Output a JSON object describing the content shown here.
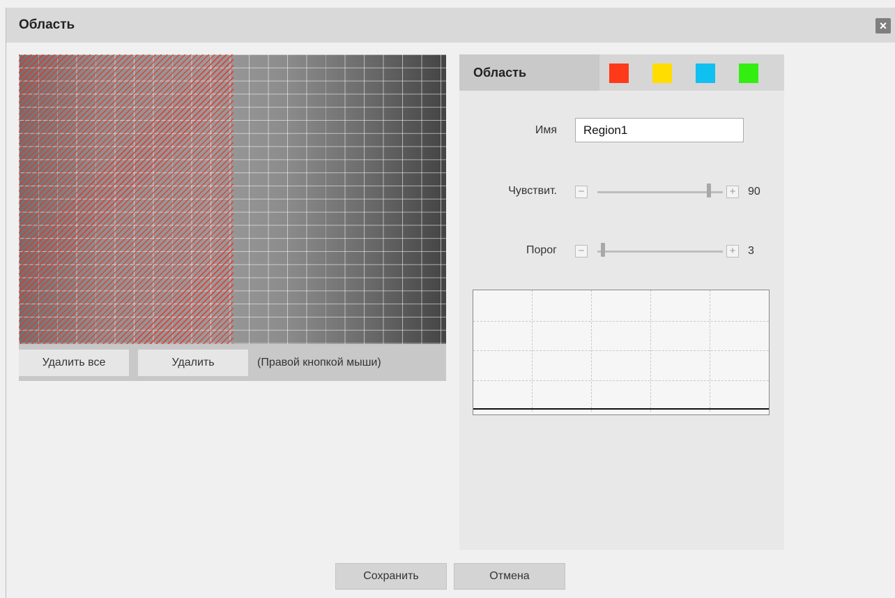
{
  "dialog": {
    "title": "Область",
    "close_glyph": "×"
  },
  "video": {
    "delete_all_label": "Удалить все",
    "delete_label": "Удалить",
    "hint": "(Правой кнопкой мыши)"
  },
  "panel": {
    "tab_label": "Область",
    "colors": [
      "#ff3a1a",
      "#ffdd00",
      "#10c0f0",
      "#33ee11"
    ],
    "selected_color": "#ff3a1a",
    "name_label": "Имя",
    "name_value": "Region1",
    "sensitivity": {
      "label": "Чувствит.",
      "value": "90",
      "level": 0.9
    },
    "threshold": {
      "label": "Порог",
      "value": "3",
      "level": 0.03
    }
  },
  "footer": {
    "save_label": "Сохранить",
    "cancel_label": "Отмена"
  }
}
